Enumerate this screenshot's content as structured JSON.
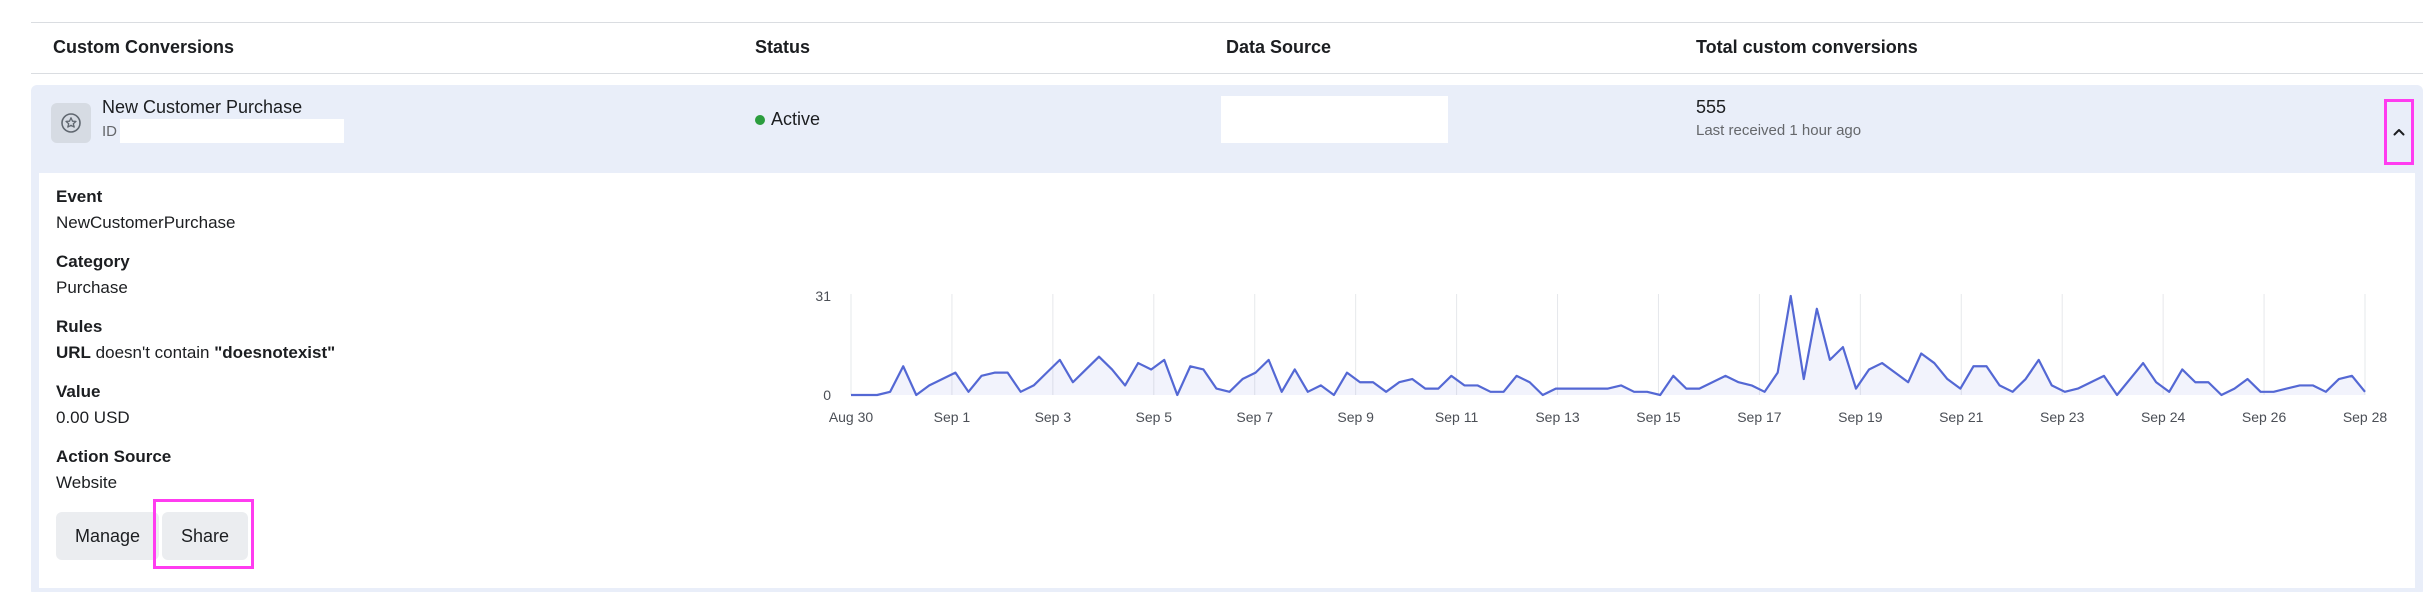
{
  "table": {
    "headers": {
      "custom_conversions": "Custom Conversions",
      "status": "Status",
      "data_source": "Data Source",
      "total": "Total custom conversions"
    },
    "row": {
      "name": "New Customer Purchase",
      "id_label": "ID",
      "status": "Active",
      "status_color": "#2b9d3e",
      "total_value": "555",
      "last_received": "Last received 1 hour ago",
      "row_icon": "star-circle-icon",
      "collapse_icon": "chevron-up-icon"
    }
  },
  "details": {
    "event": {
      "label": "Event",
      "value": "NewCustomerPurchase"
    },
    "category": {
      "label": "Category",
      "value": "Purchase"
    },
    "rules": {
      "label": "Rules",
      "field": "URL",
      "operator": " doesn't contain ",
      "operand": "\"doesnotexist\""
    },
    "value": {
      "label": "Value",
      "value": "0.00 USD"
    },
    "action_source": {
      "label": "Action Source",
      "value": "Website"
    },
    "manage_label": "Manage",
    "share_label": "Share"
  },
  "colors": {
    "accent_line": "#5468d4",
    "row_highlight": "#e9eef9",
    "annotation": "#ff3cf0"
  },
  "chart_data": {
    "type": "area",
    "x_tick_labels": [
      "Aug 30",
      "Sep 1",
      "Sep 3",
      "Sep 5",
      "Sep 7",
      "Sep 9",
      "Sep 11",
      "Sep 13",
      "Sep 15",
      "Sep 17",
      "Sep 19",
      "Sep 21",
      "Sep 23",
      "Sep 24",
      "Sep 26",
      "Sep 28"
    ],
    "y_ticks": [
      0,
      31
    ],
    "ylim": [
      0,
      31
    ],
    "grid": "vertical",
    "series": [
      {
        "values": [
          0,
          0,
          0,
          1,
          9,
          0,
          3,
          5,
          7,
          1,
          6,
          7,
          7,
          1,
          3,
          7,
          11,
          4,
          8,
          12,
          8,
          3,
          10,
          8,
          11,
          0,
          9,
          8,
          2,
          1,
          5,
          7,
          11,
          1,
          8,
          1,
          3,
          0,
          7,
          4,
          4,
          1,
          4,
          5,
          2,
          2,
          6,
          3,
          3,
          1,
          1,
          6,
          4,
          0,
          2,
          2,
          2,
          2,
          2,
          3,
          1,
          1,
          0,
          6,
          2,
          2,
          4,
          6,
          4,
          3,
          1,
          7,
          31,
          5,
          27,
          11,
          15,
          2,
          8,
          10,
          7,
          4,
          13,
          10,
          5,
          2,
          9,
          9,
          3,
          1,
          5,
          11,
          3,
          1,
          2,
          4,
          6,
          0,
          5,
          10,
          4,
          1,
          8,
          4,
          4,
          0,
          2,
          5,
          1,
          1,
          2,
          3,
          3,
          1,
          5,
          6,
          1
        ]
      }
    ]
  }
}
